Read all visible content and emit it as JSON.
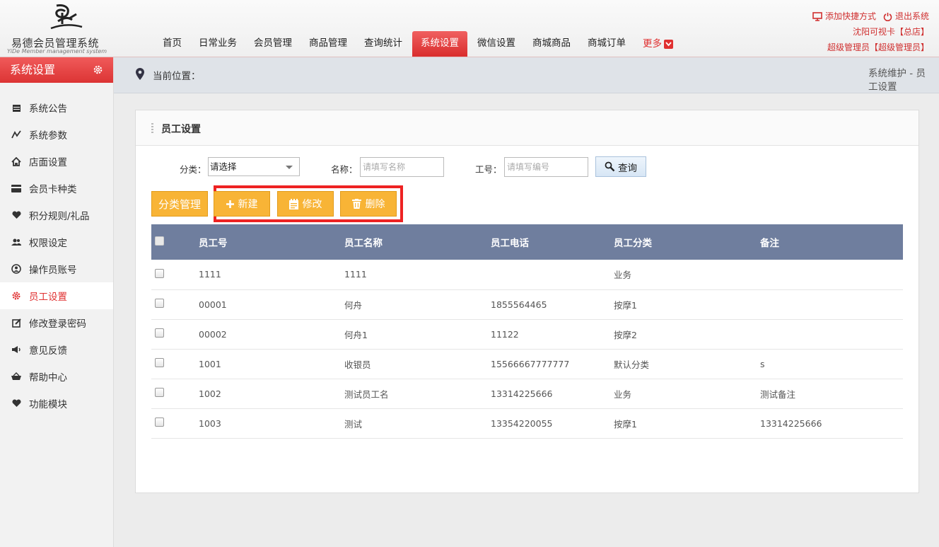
{
  "brand": {
    "title": "易德会员管理系统",
    "subtitle": "YiDe Member management system"
  },
  "nav": {
    "items": [
      "首页",
      "日常业务",
      "会员管理",
      "商品管理",
      "查询统计",
      "系统设置",
      "微信设置",
      "商城商品",
      "商城订单"
    ],
    "more_label": "更多",
    "active_index": 5
  },
  "top_right": {
    "add_shortcut": "添加快捷方式",
    "logout": "退出系统",
    "store": "沈阳可视卡【总店】",
    "user": "超级管理员【超级管理员】"
  },
  "sidebar": {
    "title": "系统设置",
    "items": [
      {
        "label": "系统公告",
        "icon": "calendar-icon"
      },
      {
        "label": "系统参数",
        "icon": "chart-icon"
      },
      {
        "label": "店面设置",
        "icon": "home-icon"
      },
      {
        "label": "会员卡种类",
        "icon": "card-icon"
      },
      {
        "label": "积分规则/礼品",
        "icon": "heart-icon"
      },
      {
        "label": "权限设定",
        "icon": "users-icon"
      },
      {
        "label": "操作员账号",
        "icon": "user-icon"
      },
      {
        "label": "员工设置",
        "icon": "gear-icon"
      },
      {
        "label": "修改登录密码",
        "icon": "edit-icon"
      },
      {
        "label": "意见反馈",
        "icon": "megaphone-icon"
      },
      {
        "label": "帮助中心",
        "icon": "basket-icon"
      },
      {
        "label": "功能模块",
        "icon": "heart-icon"
      }
    ],
    "active_index": 7
  },
  "breadcrumb": {
    "label": "当前位置：",
    "path": "系统维护 - 员工设置"
  },
  "panel": {
    "title": "员工设置",
    "filters": {
      "category_label": "分类：",
      "category_value": "请选择",
      "name_label": "名称：",
      "name_placeholder": "请填写名称",
      "code_label": "工号：",
      "code_placeholder": "请填写编号",
      "query_label": "查询"
    },
    "buttons": {
      "category_manage": "分类管理",
      "new": "新建",
      "edit": "修改",
      "delete": "删除"
    }
  },
  "table": {
    "columns": [
      "员工号",
      "员工名称",
      "员工电话",
      "员工分类",
      "备注"
    ],
    "rows": [
      [
        "1111",
        "1111",
        "",
        "业务",
        ""
      ],
      [
        "00001",
        "何舟",
        "1855564465",
        "按摩1",
        ""
      ],
      [
        "00002",
        "何舟1",
        "11122",
        "按摩2",
        ""
      ],
      [
        "1001",
        "收银员",
        "15566667777777",
        "默认分类",
        "s"
      ],
      [
        "1002",
        "测试员工名",
        "13314225666",
        "业务",
        "测试备注"
      ],
      [
        "1003",
        "测试",
        "13354220055",
        "按摩1",
        "13314225666"
      ]
    ]
  },
  "colors": {
    "accent_red": "#e03030",
    "table_header": "#6f7e9e",
    "button_orange": "#f8b436"
  }
}
